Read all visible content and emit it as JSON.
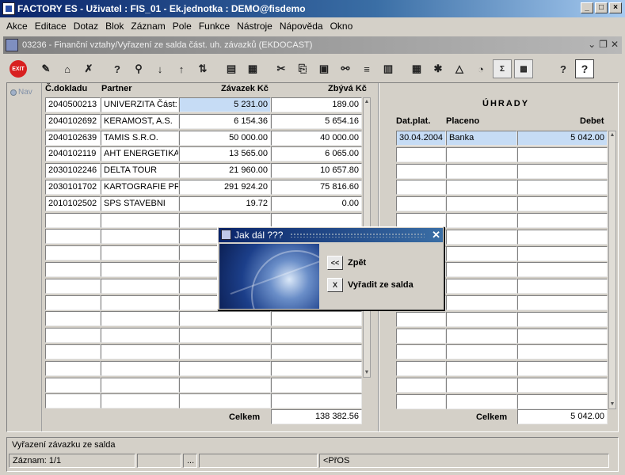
{
  "app": {
    "title": "FACTORY ES - Uživatel : FIS_01 - Ek.jednotka : DEMO@fisdemo",
    "window_buttons": [
      "_",
      "□",
      "×"
    ]
  },
  "menu": [
    "Akce",
    "Editace",
    "Dotaz",
    "Blok",
    "Záznam",
    "Pole",
    "Funkce",
    "Nástroje",
    "Nápověda",
    "Okno"
  ],
  "inner_window": {
    "title": "03236 - Finanční vztahy/Vyřazení ze salda část. uh. závazků (EKDOCAST)"
  },
  "toolbar": {
    "exit_label": "EXIT",
    "help_label": "?"
  },
  "nav": {
    "label": "Nav"
  },
  "left_table": {
    "headers": {
      "doc": "Č.dokladu",
      "partner": "Partner",
      "zavazek": "Závazek Kč",
      "zbyva": "Zbývá Kč"
    },
    "rows": [
      {
        "doc": "2040500213",
        "partner": "UNIVERZITA Část: E",
        "zavazek": "5 231.00",
        "zbyva": "189.00"
      },
      {
        "doc": "2040102692",
        "partner": "KERAMOST, A.S.",
        "zavazek": "6 154.36",
        "zbyva": "5 654.16"
      },
      {
        "doc": "2040102639",
        "partner": "TAMIS S.R.O.",
        "zavazek": "50 000.00",
        "zbyva": "40 000.00"
      },
      {
        "doc": "2040102119",
        "partner": "AHT ENERGETIKA S",
        "zavazek": "13 565.00",
        "zbyva": "6 065.00"
      },
      {
        "doc": "2030102246",
        "partner": "DELTA TOUR",
        "zavazek": "21 960.00",
        "zbyva": "10 657.80"
      },
      {
        "doc": "2030101702",
        "partner": "KARTOGRAFIE PRA",
        "zavazek": "291 924.20",
        "zbyva": "75 816.60"
      },
      {
        "doc": "2010102502",
        "partner": "SPS STAVEBNI",
        "zavazek": "19.72",
        "zbyva": "0.00"
      }
    ],
    "total_label": "Celkem",
    "total_value": "138 382.56"
  },
  "right_table": {
    "title": "ÚHRADY",
    "headers": {
      "date": "Dat.plat.",
      "placeno": "Placeno",
      "debet": "Debet"
    },
    "rows": [
      {
        "date": "30.04.2004",
        "placeno": "Banka",
        "debet": "5 042.00"
      }
    ],
    "total_label": "Celkem",
    "total_value": "5 042.00"
  },
  "dialog": {
    "title": "Jak dál ???",
    "back_icon": "<<",
    "back_label": "Zpět",
    "remove_icon": "X",
    "remove_label": "Vyřadit ze salda"
  },
  "status": {
    "message": "Vyřazení závazku ze salda",
    "record": "Záznam: 1/1",
    "seg3": "...",
    "mode": "<PřOS"
  }
}
